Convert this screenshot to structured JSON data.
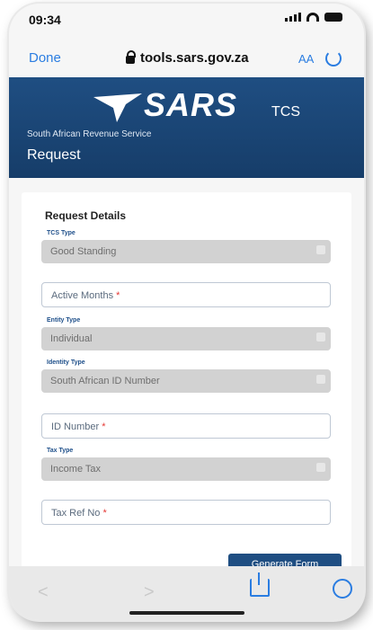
{
  "status_bar": {
    "time": "09:34"
  },
  "browser": {
    "done_label": "Done",
    "url": "tools.sars.gov.za",
    "text_size_label": "AA"
  },
  "header": {
    "brand": "SARS",
    "service_code": "TCS",
    "organisation": "South African Revenue Service",
    "page_title": "Request"
  },
  "form": {
    "title": "Request Details",
    "tcs_type": {
      "label": "TCS Type",
      "value": "Good Standing"
    },
    "active_months": {
      "placeholder": "Active Months",
      "required_mark": "*"
    },
    "entity_type": {
      "label": "Entity Type",
      "value": "Individual"
    },
    "identity_type": {
      "label": "Identity Type",
      "value": "South African ID Number"
    },
    "id_number": {
      "placeholder": "ID Number",
      "required_mark": "*"
    },
    "tax_type": {
      "label": "Tax Type",
      "value": "Income Tax"
    },
    "tax_ref": {
      "placeholder": "Tax Ref No",
      "required_mark": "*"
    },
    "generate_button": "Generate Form"
  },
  "colors": {
    "header_blue": "#1f4e82",
    "link_blue": "#2b7de1",
    "required_red": "#e53935"
  }
}
